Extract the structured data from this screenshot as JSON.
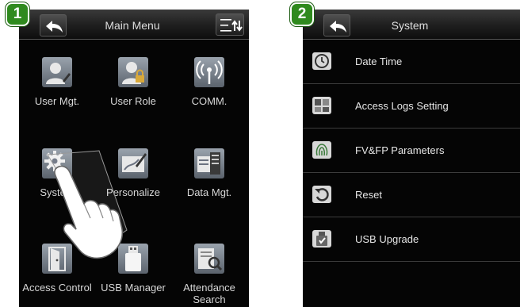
{
  "steps": {
    "first": "1",
    "second": "2"
  },
  "main_menu": {
    "title": "Main Menu",
    "items": [
      {
        "label": "User Mgt.",
        "icon": "user-edit-icon"
      },
      {
        "label": "User Role",
        "icon": "user-lock-icon"
      },
      {
        "label": "COMM.",
        "icon": "antenna-icon"
      },
      {
        "label": "System",
        "icon": "gear-icon"
      },
      {
        "label": "Personalize",
        "icon": "pen-icon"
      },
      {
        "label": "Data Mgt.",
        "icon": "server-icon"
      },
      {
        "label": "Access Control",
        "icon": "door-icon"
      },
      {
        "label": "USB Manager",
        "icon": "usb-drive-icon"
      },
      {
        "label": "Attendance Search",
        "icon": "search-document-icon"
      }
    ]
  },
  "system_menu": {
    "title": "System",
    "items": [
      {
        "label": "Date Time",
        "icon": "clock-icon"
      },
      {
        "label": "Access Logs Setting",
        "icon": "logs-icon"
      },
      {
        "label": "FV&FP Parameters",
        "icon": "fingerprint-icon"
      },
      {
        "label": "Reset",
        "icon": "reset-icon"
      },
      {
        "label": "USB Upgrade",
        "icon": "usb-upgrade-icon"
      }
    ]
  },
  "colors": {
    "badge": "#2f8a1e",
    "screen_bg": "#050505",
    "icon_bg": "#6b7280"
  }
}
